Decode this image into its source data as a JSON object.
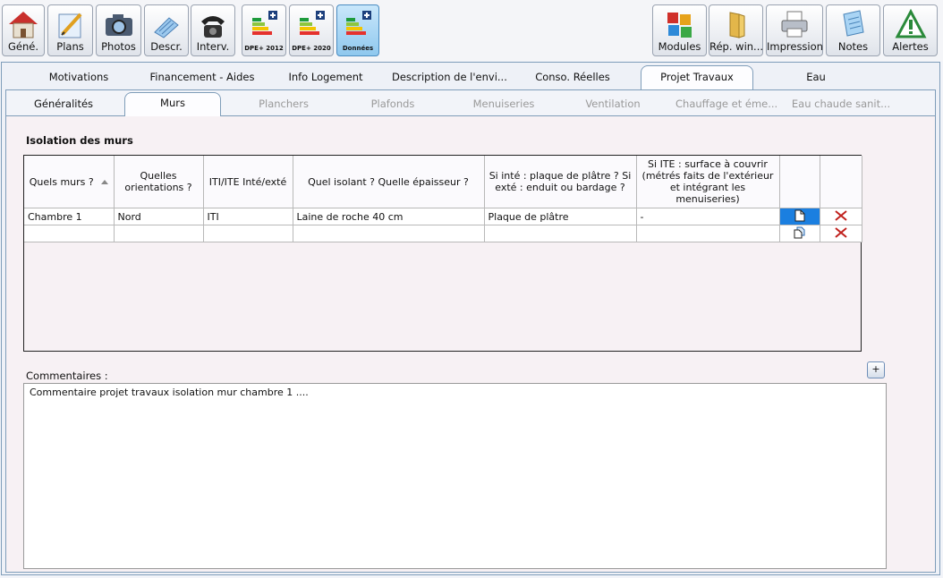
{
  "toolbar": {
    "left": [
      {
        "label": "Géné.",
        "icon": "house-icon"
      },
      {
        "label": "Plans",
        "icon": "pencil-icon"
      },
      {
        "label": "Photos",
        "icon": "camera-icon"
      },
      {
        "label": "Descr.",
        "icon": "document-icon"
      },
      {
        "label": "Interv.",
        "icon": "telephone-icon"
      },
      {
        "label": "DPE+ 2012",
        "icon": "energy-label-icon"
      },
      {
        "label": "DPE+ 2020",
        "icon": "energy-label-icon"
      },
      {
        "label": "Données",
        "icon": "energy-label-icon",
        "active": true
      }
    ],
    "right": [
      {
        "label": "Modules",
        "icon": "puzzle-icon"
      },
      {
        "label": "Rép. win...",
        "icon": "folder-icon"
      },
      {
        "label": "Impression",
        "icon": "printer-icon"
      },
      {
        "label": "Notes",
        "icon": "notes-icon"
      },
      {
        "label": "Alertes",
        "icon": "warning-triangle-icon"
      }
    ]
  },
  "main_tabs": [
    "Motivations",
    "Financement  - Aides",
    "Info Logement",
    "Description de l'envi...",
    "Conso. Réelles",
    "Projet Travaux",
    "Eau"
  ],
  "main_tab_active": "Projet Travaux",
  "sub_tabs": [
    "Généralités",
    "Murs",
    "Planchers",
    "Plafonds",
    "Menuiseries",
    "Ventilation",
    "Chauffage et éme...",
    "Eau chaude sanit..."
  ],
  "sub_tab_active": "Murs",
  "section_title": "Isolation des murs",
  "grid": {
    "headers": {
      "murs": "Quels murs ?",
      "orientations": "Quelles orientations ?",
      "iti_ite": "ITI/ITE Inté/exté",
      "isolant": "Quel isolant ? Quelle épaisseur ?",
      "plaque": "Si inté : plaque de plâtre ? Si exté : enduit ou bardage ?",
      "surface": "Si ITE : surface à couvrir (métrés faits de l'extérieur et intégrant les menuiseries)"
    },
    "rows": [
      {
        "murs": "Chambre 1",
        "orientations": "Nord",
        "iti_ite": "ITI",
        "isolant": "Laine de roche 40 cm",
        "plaque": "Plaque de plâtre",
        "surface": "-"
      },
      {
        "murs": "",
        "orientations": "",
        "iti_ite": "",
        "isolant": "",
        "plaque": "",
        "surface": ""
      }
    ]
  },
  "add_button": "+",
  "comment_label": "Commentaires :",
  "comment_value": "Commentaire projet travaux isolation mur chambre 1 ....",
  "colors": {
    "accent": "#1b7fe0",
    "delete": "#c0201c",
    "active_button": "#8fc8ee"
  }
}
